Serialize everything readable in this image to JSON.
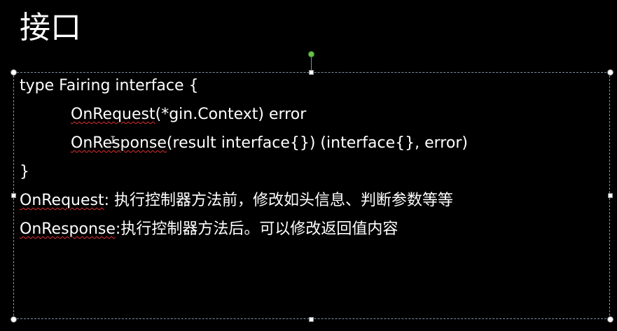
{
  "slide": {
    "title": "接口"
  },
  "code": {
    "line1": "type Fairing interface {",
    "line2_name": "OnRequest",
    "line2_rest": "(*gin.Context) error",
    "line3_name": "OnResponse",
    "line3_rest": "(result interface{}) (interface{}, error)",
    "line4": "}"
  },
  "notes": {
    "request_name": "OnRequest",
    "request_desc": ": 执行控制器方法前，修改如头信息、判断参数等等",
    "response_name": "OnResponse",
    "response_desc": ":执行控制器方法后。可以修改返回值内容"
  },
  "colors": {
    "background": "#000000",
    "text": "#ffffff",
    "spellcheck": "#e03030",
    "rotate_handle": "#6cc04a",
    "selection_border": "#7f8fa8"
  },
  "icons": {
    "cursor": "text-cursor-icon"
  }
}
